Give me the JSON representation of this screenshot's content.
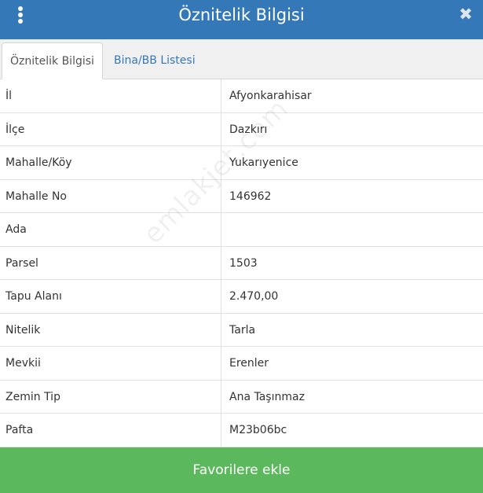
{
  "header": {
    "title": "Öznitelik Bilgisi",
    "close_glyph": "✖",
    "accent": "#3478b8"
  },
  "tabs": [
    {
      "label": "Öznitelik Bilgisi",
      "active": true
    },
    {
      "label": "Bina/BB Listesi",
      "active": false
    }
  ],
  "attributes": [
    {
      "key": "İl",
      "value": "Afyonkarahisar"
    },
    {
      "key": "İlçe",
      "value": "Dazkırı"
    },
    {
      "key": "Mahalle/Köy",
      "value": "Yukarıyenice"
    },
    {
      "key": "Mahalle No",
      "value": "146962"
    },
    {
      "key": "Ada",
      "value": ""
    },
    {
      "key": "Parsel",
      "value": "1503"
    },
    {
      "key": "Tapu Alanı",
      "value": "2.470,00"
    },
    {
      "key": "Nitelik",
      "value": "Tarla"
    },
    {
      "key": "Mevkii",
      "value": "Erenler"
    },
    {
      "key": "Zemin Tip",
      "value": "Ana Taşınmaz"
    },
    {
      "key": "Pafta",
      "value": "M23b06bc"
    }
  ],
  "watermark": "emlakjet.com",
  "footer": {
    "button_label": "Favorilere ekle",
    "button_color": "#5cb85c"
  }
}
